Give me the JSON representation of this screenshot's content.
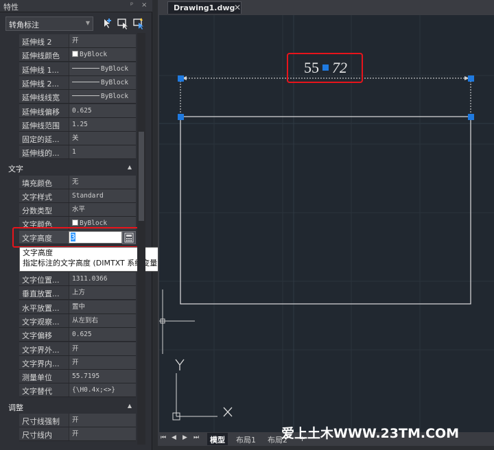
{
  "panel": {
    "title": "特性",
    "controls": {
      "pin": "ᵖ",
      "close": "×"
    },
    "selector": {
      "label": "转角标注"
    }
  },
  "lines_section": {
    "rows": [
      {
        "key": "延伸线 2",
        "value": "开"
      },
      {
        "key": "延伸线颜色",
        "value": "ByBlock",
        "swatch": "#ffffff"
      },
      {
        "key": "延伸线 1...",
        "value": "ByBlock",
        "line": true
      },
      {
        "key": "延伸线 2...",
        "value": "ByBlock",
        "line": true
      },
      {
        "key": "延伸线线宽",
        "value": "ByBlock",
        "line": true
      },
      {
        "key": "延伸线偏移",
        "value": "0.625"
      },
      {
        "key": "延伸线范围",
        "value": "1.25"
      },
      {
        "key": "固定的延...",
        "value": "关"
      },
      {
        "key": "延伸线的...",
        "value": "1"
      }
    ]
  },
  "text_section": {
    "title": "文字",
    "rows": [
      {
        "key": "填充颜色",
        "value": "无"
      },
      {
        "key": "文字样式",
        "value": "Standard"
      },
      {
        "key": "分数类型",
        "value": "水平"
      },
      {
        "key": "文字颜色",
        "value": "ByBlock",
        "swatch": "#ffffff"
      }
    ],
    "height_row": {
      "key": "文字高度",
      "value": "3"
    },
    "tooltip": {
      "title": "文字高度",
      "desc": "指定标注的文字高度 (DIMTXT 系统变量)"
    },
    "rows_after": [
      {
        "key": "文字位置...",
        "value": "1311.0366"
      },
      {
        "key": "垂直放置...",
        "value": "上方"
      },
      {
        "key": "水平放置...",
        "value": "置中"
      },
      {
        "key": "文字观察...",
        "value": "从左到右"
      },
      {
        "key": "文字偏移",
        "value": "0.625"
      },
      {
        "key": "文字界外...",
        "value": "开"
      },
      {
        "key": "文字界内...",
        "value": "开"
      },
      {
        "key": "测量单位",
        "value": "55.7195"
      },
      {
        "key": "文字替代",
        "value": "{\\H0.4x;<>}"
      }
    ]
  },
  "adjust_section": {
    "title": "调整",
    "rows": [
      {
        "key": "尺寸线强制",
        "value": "开"
      },
      {
        "key": "尺寸线内",
        "value": "开"
      }
    ]
  },
  "document": {
    "tab_label": "Drawing1.dwg",
    "close": "✕"
  },
  "drawing": {
    "dimension_text_left": "55",
    "dimension_text_right": "72",
    "ucs_y": "Y",
    "ucs_x": "X",
    "grip_color": "#1f7ae0"
  },
  "layout_tabs": {
    "nav": [
      "⏮",
      "◀",
      "▶",
      "⏭"
    ],
    "model": "模型",
    "layout1": "布局1",
    "layout2": "布局2",
    "add": "+"
  },
  "watermark": "爱上土木WWW.23TM.COM",
  "colors": {
    "highlight_box": "#e8141b",
    "canvas_bg": "#212830"
  }
}
